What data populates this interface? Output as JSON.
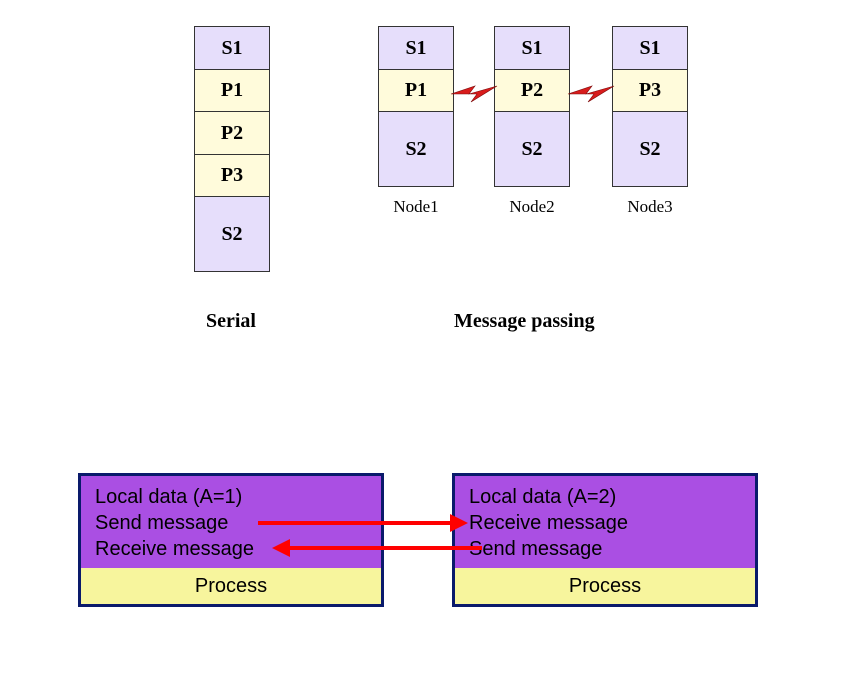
{
  "serial": {
    "cells": [
      "S1",
      "P1",
      "P2",
      "P3",
      "S2"
    ],
    "caption": "Serial"
  },
  "mp": {
    "nodes": [
      {
        "cells": [
          "S1",
          "P1",
          "S2"
        ],
        "label": "Node1"
      },
      {
        "cells": [
          "S1",
          "P2",
          "S2"
        ],
        "label": "Node2"
      },
      {
        "cells": [
          "S1",
          "P3",
          "S2"
        ],
        "label": "Node3"
      }
    ],
    "caption": "Message passing"
  },
  "procs": {
    "left": {
      "lines": [
        "Local data (A=1)",
        "Send message",
        "Receive message"
      ],
      "footer": "Process"
    },
    "right": {
      "lines": [
        "Local data (A=2)",
        "Receive message",
        "Send message"
      ],
      "footer": "Process"
    }
  }
}
